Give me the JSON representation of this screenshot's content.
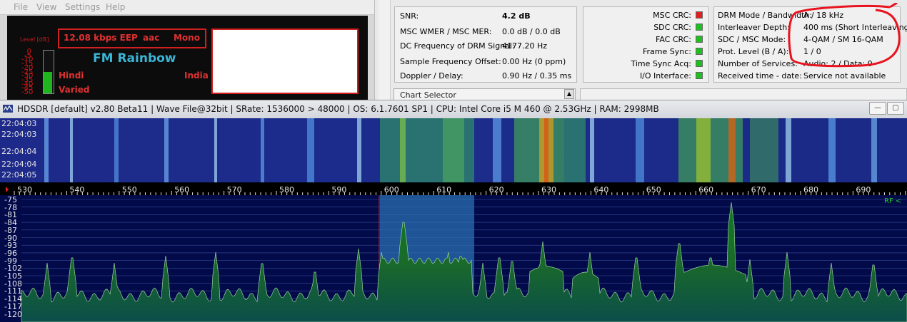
{
  "dream": {
    "menu": [
      "File",
      "View",
      "Settings",
      "Help"
    ],
    "level_label": "Level [dB]",
    "level_ticks": [
      "0",
      "-5",
      "-10",
      "-15",
      "-20",
      "-25",
      "-30",
      "-35",
      "-40",
      "-45",
      "-50"
    ],
    "level_fraction": 0.5,
    "service": {
      "bitrate": "12.08 kbps EEP",
      "codec": "aac",
      "mode": "Mono"
    },
    "station": "FM Rainbow",
    "language": "Hindi",
    "country": "India",
    "program_type": "Varied"
  },
  "stats": [
    {
      "label": "SNR:",
      "value": "4.2 dB"
    },
    {
      "label": "MSC WMER / MSC MER:",
      "value": "0.0 dB / 0.0 dB"
    },
    {
      "label": "DC Frequency of DRM Signal:",
      "value": "4177.20 Hz"
    },
    {
      "label": "Sample Frequency Offset:",
      "value": "0.00 Hz (0 ppm)"
    },
    {
      "label": "Doppler / Delay:",
      "value": "0.90 Hz / 0.35 ms"
    }
  ],
  "crc": [
    {
      "label": "MSC CRC:",
      "color": "#e02020"
    },
    {
      "label": "SDC CRC:",
      "color": "#1fbf1f"
    },
    {
      "label": "FAC CRC:",
      "color": "#1fbf1f"
    },
    {
      "label": "Frame Sync:",
      "color": "#1fbf1f"
    },
    {
      "label": "Time Sync Acq:",
      "color": "#1fbf1f"
    },
    {
      "label": "I/O Interface:",
      "color": "#1fbf1f"
    }
  ],
  "drm_info": [
    {
      "label": "DRM Mode / Bandwidth:",
      "value": "A / 18 kHz"
    },
    {
      "label": "Interleaver Depth:",
      "value": "400 ms (Short Interleaving)"
    },
    {
      "label": "SDC / MSC Mode:",
      "value": "4-QAM / SM 16-QAM"
    },
    {
      "label": "Prot. Level (B / A):",
      "value": "1 / 0"
    },
    {
      "label": "Number of Services:",
      "value": "Audio: 2 / Data: 0"
    },
    {
      "label": "Received time - date:",
      "value": "Service not available"
    }
  ],
  "chart_selector": "Chart Selector",
  "hdsdr": {
    "title": "HDSDR  [default]  v2.80 Beta11  |  Wave File@32bit  |  SRate: 1536000 > 48000  |  OS: 6.1.7601 SP1  |  CPU: Intel Core i5       M 460  @ 2.53GHz  |  RAM: 2998MB",
    "waterfall_times": [
      "22:04:03",
      "22:04:03",
      "22:04:04",
      "22:04:04",
      "22:04:05"
    ],
    "freq_labels": [
      "530",
      "540",
      "550",
      "560",
      "570",
      "580",
      "590",
      "600",
      "610",
      "620",
      "630",
      "640",
      "650",
      "660",
      "670",
      "680",
      "690"
    ],
    "db_labels": [
      "-75",
      "-78",
      "-81",
      "-84",
      "-87",
      "-90",
      "-93",
      "-96",
      "-99",
      "-102",
      "-105",
      "-108",
      "-111",
      "-114",
      "-117",
      "-120"
    ],
    "rf_label": "RF <"
  }
}
